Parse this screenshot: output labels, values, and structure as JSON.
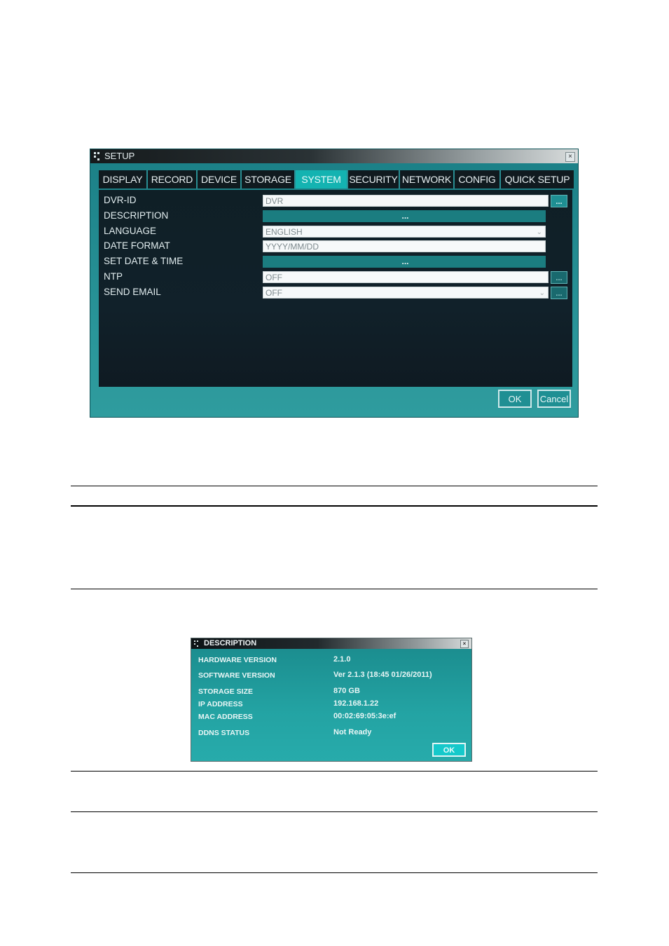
{
  "setup_window": {
    "title": "SETUP",
    "close": "×",
    "tabs": [
      {
        "label": "DISPLAY",
        "active": false
      },
      {
        "label": "RECORD",
        "active": false
      },
      {
        "label": "DEVICE",
        "active": false
      },
      {
        "label": "STORAGE",
        "active": false
      },
      {
        "label": "SYSTEM",
        "active": true
      },
      {
        "label": "SECURITY",
        "active": false
      },
      {
        "label": "NETWORK",
        "active": false
      },
      {
        "label": "CONFIG",
        "active": false
      },
      {
        "label": "QUICK SETUP",
        "active": false
      }
    ],
    "rows": [
      {
        "label": "DVR-ID",
        "value": "DVR",
        "button": "..."
      },
      {
        "label": "DESCRIPTION",
        "value": "..."
      },
      {
        "label": "LANGUAGE",
        "value": "ENGLISH"
      },
      {
        "label": "DATE FORMAT",
        "value": "YYYY/MM/DD"
      },
      {
        "label": "SET DATE & TIME",
        "value": "..."
      },
      {
        "label": "NTP",
        "value": "OFF",
        "button": "..."
      },
      {
        "label": "SEND EMAIL",
        "value": "OFF",
        "button": "..."
      }
    ],
    "ok_label": "OK",
    "cancel_label": "Cancel"
  },
  "description_window": {
    "title": "DESCRIPTION",
    "close": "×",
    "rows": [
      {
        "label": "HARDWARE VERSION",
        "value": "2.1.0"
      },
      {
        "label": "SOFTWARE VERSION",
        "value": "Ver 2.1.3 (18:45 01/26/2011)"
      },
      {
        "label": "STORAGE SIZE",
        "value": "870 GB"
      },
      {
        "label": "IP ADDRESS",
        "value": "192.168.1.22"
      },
      {
        "label": "MAC ADDRESS",
        "value": "00:02:69:05:3e:ef"
      },
      {
        "label": "DDNS STATUS",
        "value": "Not Ready"
      }
    ],
    "ok_label": "OK"
  }
}
